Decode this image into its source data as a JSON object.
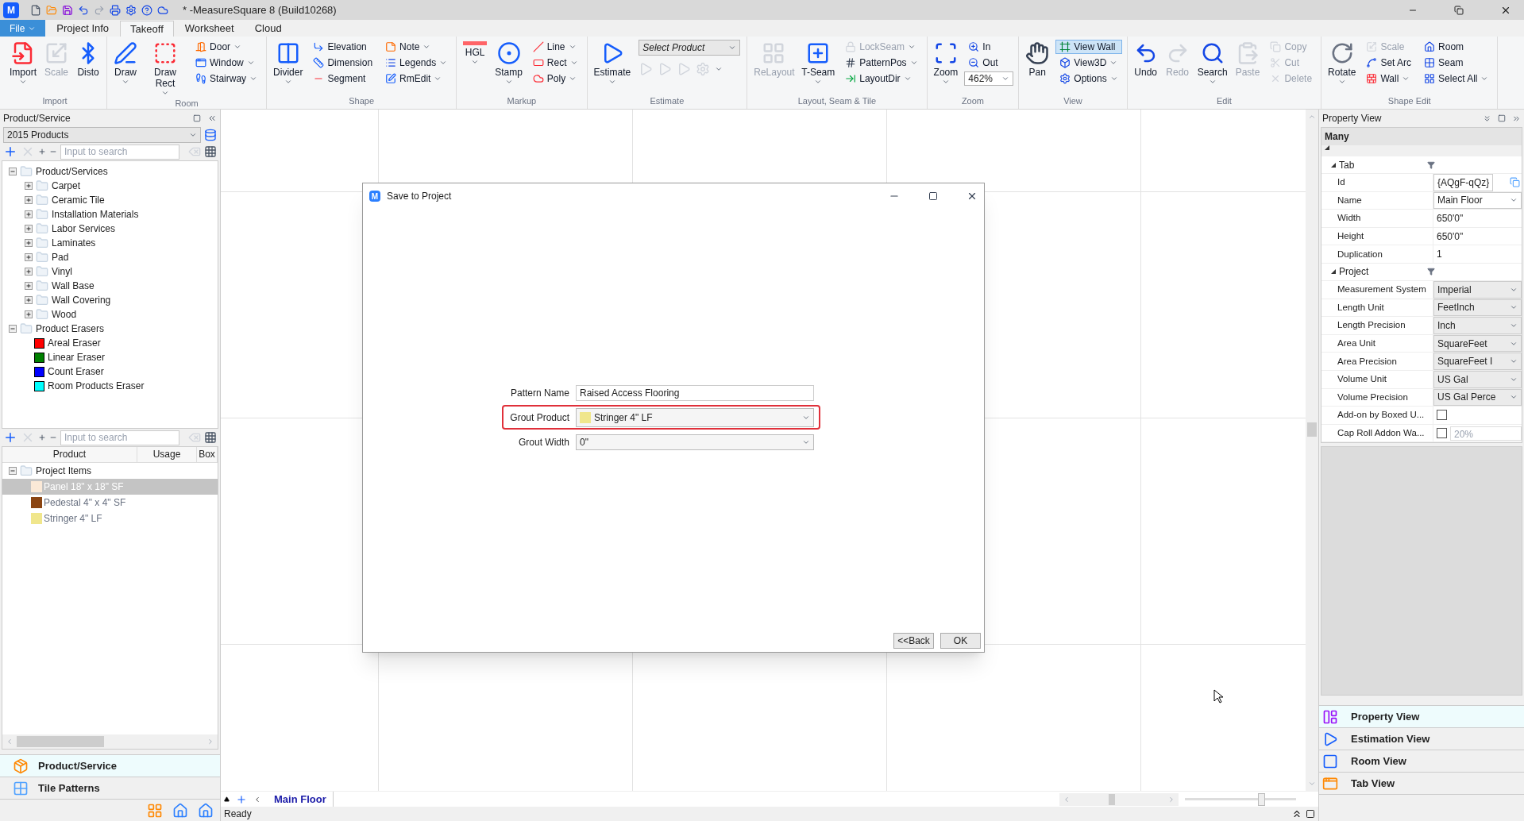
{
  "logo_text": "M",
  "title": "* -MeasureSquare 8 (Build10268)",
  "menu_tabs": [
    {
      "label": "File",
      "kind": "app",
      "selected": false
    },
    {
      "label": "Project Info",
      "kind": "tab",
      "selected": false
    },
    {
      "label": "Takeoff",
      "kind": "tab",
      "selected": true
    },
    {
      "label": "Worksheet",
      "kind": "tab",
      "selected": false
    },
    {
      "label": "Cloud",
      "kind": "tab",
      "selected": false
    }
  ],
  "ribbon": [
    {
      "label": "Import",
      "columns": [
        {
          "kind": "large",
          "label": "Import",
          "caret": true,
          "disabled": false
        },
        {
          "kind": "large",
          "label": "Scale",
          "caret": false,
          "disabled": true
        },
        {
          "kind": "large",
          "label": "Disto",
          "caret": false,
          "disabled": false
        }
      ]
    },
    {
      "label": "Room",
      "columns": [
        {
          "kind": "large",
          "label": "Draw",
          "caret": true,
          "disabled": false
        },
        {
          "kind": "large",
          "label": "Draw Rect",
          "caret": true,
          "disabled": false
        },
        {
          "kind": "stack",
          "items": [
            {
              "label": "Door",
              "caret": true,
              "disabled": false,
              "on": false
            },
            {
              "label": "Window",
              "caret": true,
              "disabled": false,
              "on": false
            },
            {
              "label": "Stairway",
              "caret": true,
              "disabled": false,
              "on": false
            }
          ]
        }
      ]
    },
    {
      "label": "Shape",
      "columns": [
        {
          "kind": "large",
          "label": "Divider",
          "caret": true,
          "disabled": false
        },
        {
          "kind": "stack",
          "items": [
            {
              "label": "Elevation",
              "caret": false,
              "disabled": false,
              "on": false
            },
            {
              "label": "Dimension",
              "caret": false,
              "disabled": false,
              "on": false
            },
            {
              "label": "Segment",
              "caret": false,
              "disabled": false,
              "on": false
            }
          ]
        },
        {
          "kind": "stack",
          "items": [
            {
              "label": "Note",
              "caret": true,
              "disabled": false,
              "on": false
            },
            {
              "label": "Legends",
              "caret": true,
              "disabled": false,
              "on": false
            },
            {
              "label": "RmEdit",
              "caret": true,
              "disabled": false,
              "on": false
            }
          ]
        }
      ]
    },
    {
      "label": "Markup",
      "columns": [
        {
          "kind": "large",
          "label": "HGL",
          "caret": true,
          "disabled": false
        },
        {
          "kind": "large",
          "label": "Stamp",
          "caret": true,
          "disabled": false
        },
        {
          "kind": "stack",
          "items": [
            {
              "label": "Line",
              "caret": true,
              "disabled": false,
              "on": false
            },
            {
              "label": "Rect",
              "caret": true,
              "disabled": false,
              "on": false
            },
            {
              "label": "Poly",
              "caret": true,
              "disabled": false,
              "on": false
            }
          ]
        }
      ]
    },
    {
      "label": "Estimate",
      "columns": [
        {
          "kind": "large",
          "label": "Estimate",
          "caret": true,
          "disabled": false
        },
        {
          "kind": "combo_panel",
          "value": "Select Product"
        }
      ]
    },
    {
      "label": "Layout, Seam & Tile",
      "columns": [
        {
          "kind": "large",
          "label": "ReLayout",
          "caret": false,
          "disabled": true
        },
        {
          "kind": "large",
          "label": "T-Seam",
          "caret": true,
          "disabled": false
        },
        {
          "kind": "stack",
          "items": [
            {
              "label": "LockSeam",
              "caret": true,
              "disabled": true,
              "on": false
            },
            {
              "label": "PatternPos",
              "caret": true,
              "disabled": false,
              "on": false
            },
            {
              "label": "LayoutDir",
              "caret": true,
              "disabled": false,
              "on": false
            }
          ]
        }
      ]
    },
    {
      "label": "Zoom",
      "columns": [
        {
          "kind": "large",
          "label": "Zoom",
          "caret": true,
          "disabled": false
        },
        {
          "kind": "stack",
          "items": [
            {
              "kind": "button",
              "label": "In",
              "caret": false,
              "disabled": false,
              "on": false
            },
            {
              "kind": "button",
              "label": "Out",
              "caret": false,
              "disabled": false,
              "on": false
            },
            {
              "kind": "combo",
              "value": "462%"
            }
          ]
        }
      ]
    },
    {
      "label": "View",
      "columns": [
        {
          "kind": "large",
          "label": "Pan",
          "caret": false,
          "disabled": false
        },
        {
          "kind": "stack",
          "items": [
            {
              "label": "View Wall",
              "caret": false,
              "disabled": false,
              "on": true
            },
            {
              "label": "View3D",
              "caret": true,
              "disabled": false,
              "on": false
            },
            {
              "label": "Options",
              "caret": true,
              "disabled": false,
              "on": false
            }
          ]
        }
      ]
    },
    {
      "label": "Edit",
      "columns": [
        {
          "kind": "large",
          "label": "Undo",
          "caret": false,
          "disabled": false
        },
        {
          "kind": "large",
          "label": "Redo",
          "caret": false,
          "disabled": true
        },
        {
          "kind": "large",
          "label": "Search",
          "caret": true,
          "disabled": false
        },
        {
          "kind": "large",
          "label": "Paste",
          "caret": false,
          "disabled": true
        },
        {
          "kind": "stack",
          "items": [
            {
              "label": "Copy",
              "caret": false,
              "disabled": true,
              "on": false
            },
            {
              "label": "Cut",
              "caret": false,
              "disabled": true,
              "on": false
            },
            {
              "label": "Delete",
              "caret": false,
              "disabled": true,
              "on": false
            }
          ]
        }
      ]
    },
    {
      "label": "Shape Edit",
      "columns": [
        {
          "kind": "large",
          "label": "Rotate",
          "caret": true,
          "disabled": false
        },
        {
          "kind": "stack",
          "items": [
            {
              "label": "Scale",
              "caret": false,
              "disabled": true,
              "on": false
            },
            {
              "label": "Set Arc",
              "caret": false,
              "disabled": false,
              "on": false
            },
            {
              "label": "Wall",
              "caret": true,
              "disabled": false,
              "on": false
            }
          ]
        },
        {
          "kind": "stack",
          "items": [
            {
              "label": "Room",
              "caret": false,
              "disabled": false,
              "on": false
            },
            {
              "label": "Seam",
              "caret": false,
              "disabled": false,
              "on": false
            },
            {
              "label": "Select All",
              "caret": true,
              "disabled": false,
              "on": false
            }
          ]
        }
      ]
    }
  ],
  "product_panel": {
    "title": "Product/Service",
    "catalog": "2015 Products",
    "search_placeholder": "Input to search",
    "tree": [
      {
        "label": "Product/Services",
        "expanded": true,
        "children": [
          {
            "label": "Carpet",
            "kind": "folder",
            "expanded": false
          },
          {
            "label": "Ceramic Tile",
            "kind": "folder",
            "expanded": false
          },
          {
            "label": "Installation Materials",
            "kind": "folder",
            "expanded": false
          },
          {
            "label": "Labor Services",
            "kind": "folder",
            "expanded": false
          },
          {
            "label": "Laminates",
            "kind": "folder",
            "expanded": false
          },
          {
            "label": "Pad",
            "kind": "folder",
            "expanded": false
          },
          {
            "label": "Vinyl",
            "kind": "folder",
            "expanded": false
          },
          {
            "label": "Wall Base",
            "kind": "folder",
            "expanded": false
          },
          {
            "label": "Wall Covering",
            "kind": "folder",
            "expanded": false
          },
          {
            "label": "Wood",
            "kind": "folder",
            "expanded": false
          }
        ]
      },
      {
        "label": "Product Erasers",
        "expanded": true,
        "children": [
          {
            "label": "Areal Eraser",
            "kind": "swatch",
            "color": "#ff0000"
          },
          {
            "label": "Linear Eraser",
            "kind": "swatch",
            "color": "#008000"
          },
          {
            "label": "Count Eraser",
            "kind": "swatch",
            "color": "#0000ff"
          },
          {
            "label": "Room Products Eraser",
            "kind": "swatch",
            "color": "#00ffff"
          }
        ]
      }
    ]
  },
  "project_items": {
    "search_placeholder": "Input to search",
    "columns": [
      "Product",
      "Usage",
      "Box"
    ],
    "group": {
      "label": "Project Items",
      "expanded": true
    },
    "items": [
      {
        "label": "Panel 18\" x 18\" SF",
        "color": "#fbe9d7",
        "selected": true
      },
      {
        "label": "Pedestal 4\" x 4\" SF",
        "color": "#8b4513",
        "selected": false
      },
      {
        "label": "Stringer 4\" LF",
        "color": "#f0e68c",
        "selected": false
      }
    ]
  },
  "left_nav": [
    {
      "label": "Product/Service",
      "selected": true
    },
    {
      "label": "Tile Patterns",
      "selected": false
    }
  ],
  "sheet_tabs": [
    {
      "label": "Main Floor",
      "selected": true
    }
  ],
  "zoom_slider": {
    "level": 0.7
  },
  "status": "Ready",
  "dialog": {
    "logo_text": "M",
    "title": "Save to Project",
    "fields": [
      {
        "label": "Pattern Name",
        "kind": "text",
        "value": "Raised Access Flooring",
        "highlighted": false
      },
      {
        "label": "Grout Product",
        "kind": "combo",
        "value": "Stringer 4\" LF",
        "color": "#f0e68c",
        "highlighted": true
      },
      {
        "label": "Grout Width",
        "kind": "combo",
        "value": "0\"",
        "highlighted": false
      }
    ],
    "buttons": [
      "<<Back",
      "OK"
    ]
  },
  "property_view": {
    "title": "Property View",
    "object": "Many",
    "sections": [
      {
        "label": "Tab",
        "expanded": true,
        "rows": [
          {
            "name": "Id",
            "kind": "id",
            "value": "{AQgF-qQz}"
          },
          {
            "name": "Name",
            "kind": "combo",
            "value": "Main Floor"
          },
          {
            "name": "Width",
            "kind": "text",
            "value": "650'0\""
          },
          {
            "name": "Height",
            "kind": "text",
            "value": "650'0\""
          },
          {
            "name": "Duplication",
            "kind": "text",
            "value": "1"
          }
        ]
      },
      {
        "label": "Project",
        "expanded": true,
        "rows": [
          {
            "name": "Measurement System",
            "kind": "combo",
            "value": "Imperial"
          },
          {
            "name": "Length Unit",
            "kind": "combo",
            "value": "FeetInch"
          },
          {
            "name": "Length Precision",
            "kind": "combo",
            "value": "Inch"
          },
          {
            "name": "Area Unit",
            "kind": "combo",
            "value": "SquareFeet"
          },
          {
            "name": "Area Precision",
            "kind": "combo",
            "value": "SquareFeet I"
          },
          {
            "name": "Volume Unit",
            "kind": "combo",
            "value": "US Gal"
          },
          {
            "name": "Volume Precision",
            "kind": "combo",
            "value": "US Gal Perce"
          },
          {
            "name": "Add-on by Boxed U...",
            "kind": "check",
            "checked": false
          },
          {
            "name": "Cap Roll Addon Wa...",
            "kind": "check",
            "checked": false,
            "value": "20%"
          }
        ]
      }
    ]
  },
  "right_nav": [
    {
      "label": "Property View",
      "selected": true
    },
    {
      "label": "Estimation View",
      "selected": false
    },
    {
      "label": "Room View",
      "selected": false
    },
    {
      "label": "Tab View",
      "selected": false
    }
  ]
}
